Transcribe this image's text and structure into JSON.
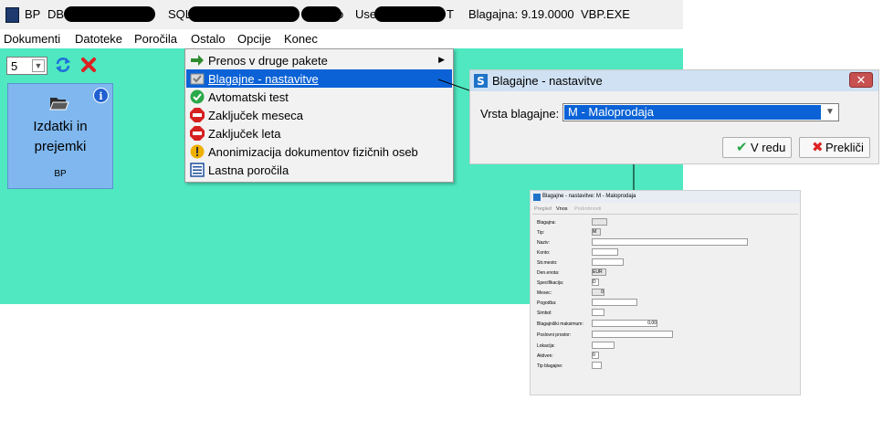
{
  "titlebar": {
    "app": "BP",
    "db": "DB",
    "sql": "SQL",
    "s_fragment": "S",
    "o_fragment": "o",
    "user": "Use",
    "t_fragment": "T",
    "version": "Blagajna: 9.19.0000",
    "exe": "VBP.EXE"
  },
  "menubar": [
    "Dokumenti",
    "Datoteke",
    "Poročila",
    "Ostalo",
    "Opcije",
    "Konec"
  ],
  "toolbar": {
    "select_value": "5"
  },
  "tile": {
    "line1": "Izdatki in",
    "line2": "prejemki",
    "code": "BP"
  },
  "dropdown": {
    "items": [
      {
        "label": "Prenos v druge pakete",
        "icon": "arrow-right-icon"
      },
      {
        "label": "Blagajne - nastavitve",
        "icon": "settings-icon"
      },
      {
        "label": "Avtomatski test",
        "icon": "check-icon"
      },
      {
        "label": "Zaključek meseca",
        "icon": "stop-icon"
      },
      {
        "label": "Zaključek leta",
        "icon": "stop-icon"
      },
      {
        "label": "Anonimizacija dokumentov fizičnih oseb",
        "icon": "warning-icon"
      },
      {
        "label": "Lastna poročila",
        "icon": "list-icon"
      }
    ]
  },
  "dialog": {
    "title": "Blagajne - nastavitve",
    "field_label": "Vrsta blagajne:",
    "field_value": "M - Maloprodaja",
    "ok_label": "V redu",
    "cancel_label": "Prekliči"
  },
  "form": {
    "title": "Blagajne - nastavitve: M - Maloprodaja",
    "tabs": [
      "Pregled",
      "Vnos",
      "Podrobnosti"
    ],
    "labels": [
      "Blagajna:",
      "Tip:",
      "Naziv:",
      "Konto:",
      "Str.mesto:",
      "Den.enota:",
      "Specifikacija:",
      "Mesec:",
      "Pogodba:",
      "Simbol:",
      "Blagajniški maksimum:",
      "Poslovni prostor:",
      "Lokacija:",
      "Aktiven:",
      "Tip blagajne:"
    ],
    "values": {
      "tip": "M",
      "den_enota": "EUR",
      "specifikacija": "D",
      "mesec": "0",
      "maksimum": "0,00",
      "aktiven": "0"
    }
  }
}
